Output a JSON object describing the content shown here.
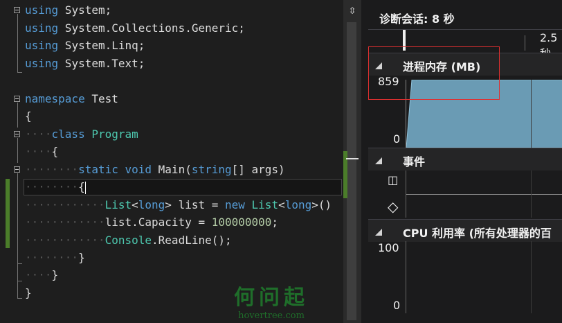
{
  "editor": {
    "lines": [
      {
        "kw": "using",
        "rest": " System;"
      },
      {
        "kw": "using",
        "rest": " System.Collections.Generic;"
      },
      {
        "kw": "using",
        "rest": " System.Linq;"
      },
      {
        "kw": "using",
        "rest": " System.Text;"
      },
      {
        "kw": "namespace",
        "rest": " Test"
      },
      {
        "text": "{"
      },
      {
        "kw": "class",
        "ty": "Program"
      },
      {
        "text": "{"
      },
      {
        "kw1": "static",
        "kw2": "void",
        "rest": " Main(",
        "kw3": "string",
        "rest2": "[] args)"
      },
      {
        "text": "{"
      },
      {
        "ty1": "List",
        "lt1": "<",
        "kw": "long",
        "gt1": ">",
        "mid": " list = ",
        "kw2": "new",
        "ty2": " List",
        "lt2": "<",
        "kw3": "long",
        "gt2": ">",
        "end": "()"
      },
      {
        "pre": "list.Capacity = ",
        "num": "100000000",
        "end": ";"
      },
      {
        "ty": "Console",
        "rest": ".ReadLine();"
      },
      {
        "text": "}"
      },
      {
        "text": "}"
      },
      {
        "text": "}"
      }
    ],
    "split_icon": "split-vertical-icon"
  },
  "diagnostics": {
    "session_label": "诊断会话: 8 秒",
    "ruler_label": "2.5秒",
    "memory": {
      "title": "进程内存 (MB)",
      "max": "859",
      "min": "0",
      "value_mb": 859
    },
    "events": {
      "title": "事件",
      "pause_icon": "pause-icon",
      "diamond_icon": "diamond-icon"
    },
    "cpu": {
      "title": "CPU 利用率 (所有处理器的百",
      "max": "100",
      "min": "0"
    }
  },
  "watermark": {
    "cn": "何问起",
    "en": "hovertree.com"
  },
  "colors": {
    "keyword": "#569cd6",
    "type": "#4ec9b0",
    "number": "#b5cea8",
    "memory_fill": "#6a9bb4",
    "highlight": "#e03030"
  }
}
